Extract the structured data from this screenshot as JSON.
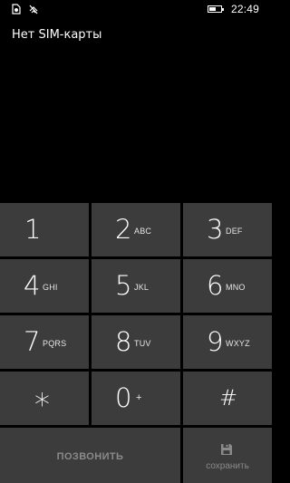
{
  "status_bar": {
    "sim_icon": "no-sim-icon",
    "signal_icon": "no-signal-icon",
    "battery_icon": "battery-icon",
    "battery_level": 0.55,
    "time": "22:49"
  },
  "header": {
    "sim_status": "Нет SIM-карты"
  },
  "keypad": {
    "keys": [
      {
        "digit": "1",
        "letters": ""
      },
      {
        "digit": "2",
        "letters": "ABC"
      },
      {
        "digit": "3",
        "letters": "DEF"
      },
      {
        "digit": "4",
        "letters": "GHI"
      },
      {
        "digit": "5",
        "letters": "JKL"
      },
      {
        "digit": "6",
        "letters": "MNO"
      },
      {
        "digit": "7",
        "letters": "PQRS"
      },
      {
        "digit": "8",
        "letters": "TUV"
      },
      {
        "digit": "9",
        "letters": "WXYZ"
      },
      {
        "digit": "*",
        "letters": ""
      },
      {
        "digit": "0",
        "letters": "+"
      },
      {
        "digit": "#",
        "letters": ""
      }
    ],
    "call_label": "ПОЗВОНИТЬ",
    "save_label": "сохранить",
    "save_icon": "save-icon"
  },
  "colors": {
    "background": "#000000",
    "key_background": "#3c3c3c",
    "disabled_text": "#8a8a8a"
  }
}
